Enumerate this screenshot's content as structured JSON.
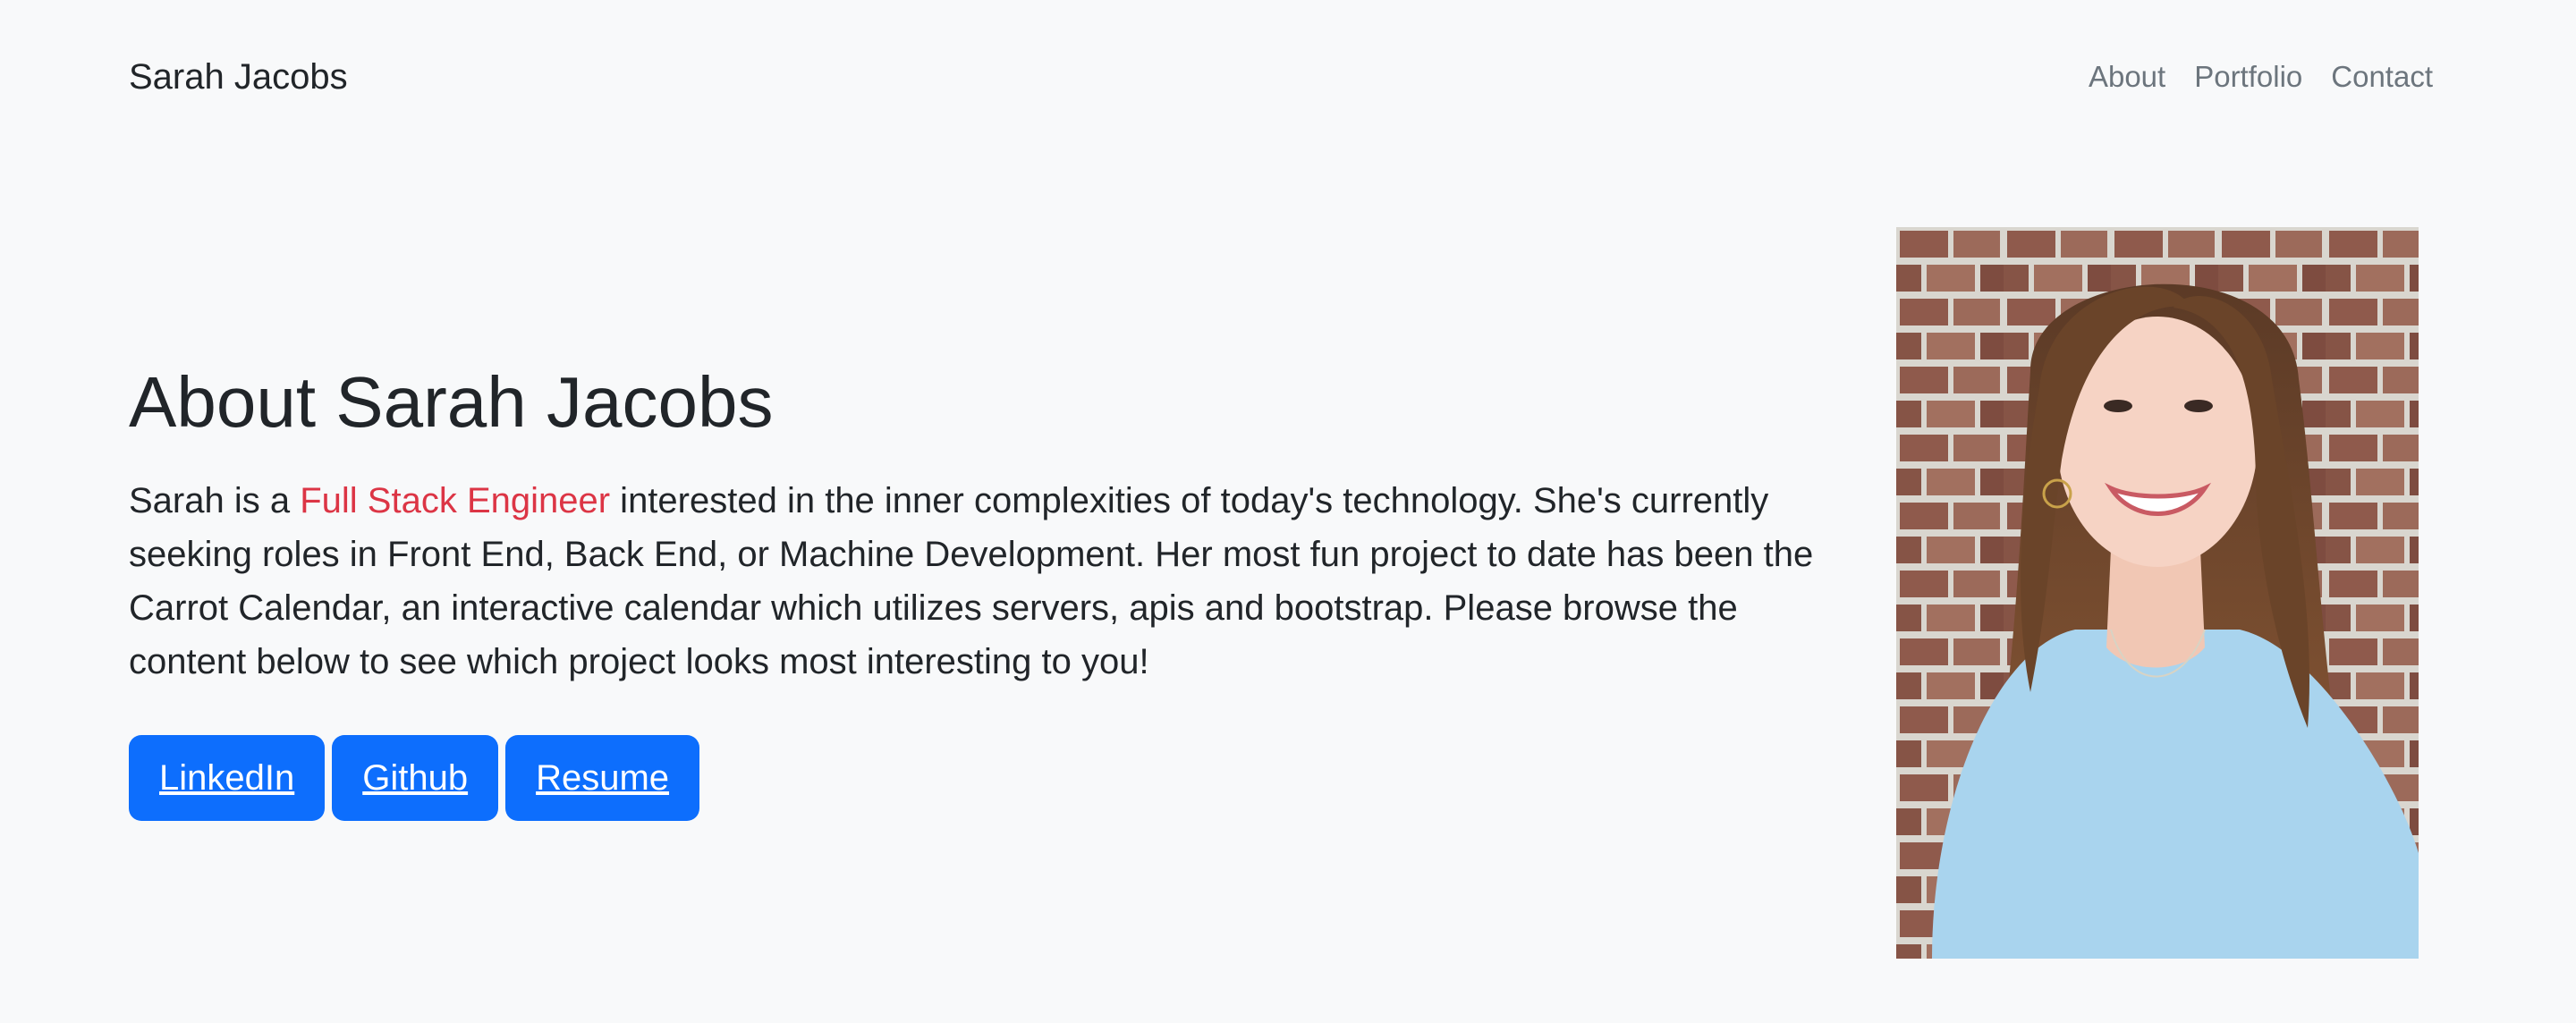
{
  "navbar": {
    "brand": "Sarah Jacobs",
    "links": [
      {
        "label": "About"
      },
      {
        "label": "Portfolio"
      },
      {
        "label": "Contact"
      }
    ]
  },
  "hero": {
    "title": "About Sarah Jacobs",
    "text_before": "Sarah is a ",
    "highlight": "Full Stack Engineer",
    "text_after": " interested in the inner complexities of today's technology. She's currently seeking roles in Front End, Back End, or Machine Development. Her most fun project to date has been the Carrot Calendar, an interactive calendar which utilizes servers, apis and bootstrap. Please browse the content below to see which project looks most interesting to you!",
    "buttons": [
      {
        "label": "LinkedIn"
      },
      {
        "label": "Github"
      },
      {
        "label": "Resume"
      }
    ]
  },
  "colors": {
    "background": "#f8f9fa",
    "accent": "#dc3545",
    "button": "#0d6efd",
    "nav_link": "#6c757d"
  },
  "photo": {
    "subject": "portrait-photo"
  }
}
